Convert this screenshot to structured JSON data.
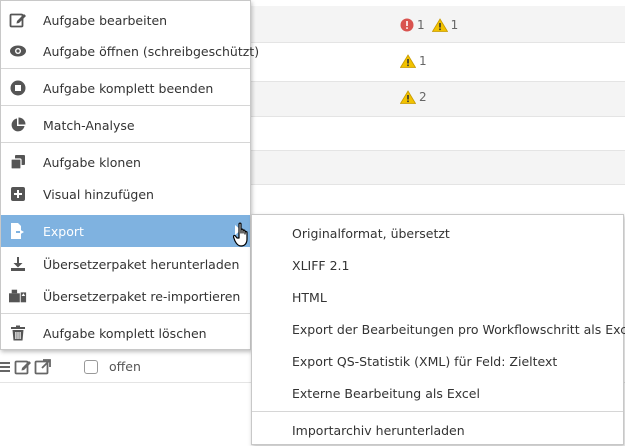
{
  "background_rows": [
    {
      "errors": "1",
      "warnings": "1"
    },
    {
      "errors": null,
      "warnings": "1"
    },
    {
      "errors": null,
      "warnings": "2"
    }
  ],
  "menu": {
    "items": [
      {
        "label": "Aufgabe bearbeiten",
        "icon": "edit-icon"
      },
      {
        "label": "Aufgabe öffnen (schreibgeschützt)",
        "icon": "eye-icon"
      },
      {
        "label": "Aufgabe komplett beenden",
        "icon": "stop-icon"
      },
      {
        "label": "Match-Analyse",
        "icon": "pie-chart-icon"
      },
      {
        "label": "Aufgabe klonen",
        "icon": "clone-icon"
      },
      {
        "label": "Visual hinzufügen",
        "icon": "plus-square-icon"
      },
      {
        "label": "Export",
        "icon": "file-export-icon",
        "active": true
      },
      {
        "label": "Übersetzerpaket herunterladen",
        "icon": "download-icon"
      },
      {
        "label": "Übersetzerpaket re-importieren",
        "icon": "reimport-icon"
      },
      {
        "label": "Aufgabe komplett löschen",
        "icon": "trash-icon"
      }
    ]
  },
  "submenu": {
    "items": [
      {
        "label": "Originalformat, übersetzt"
      },
      {
        "label": "XLIFF 2.1"
      },
      {
        "label": "HTML"
      },
      {
        "label": "Export der Bearbeitungen pro Workflowschritt als Excel"
      },
      {
        "label": "Export QS-Statistik (XML) für Feld: Zieltext"
      },
      {
        "label": "Externe Bearbeitung als Excel"
      },
      {
        "label": "Importarchiv herunterladen"
      }
    ]
  },
  "bottom_row": {
    "status": "offen"
  },
  "colors": {
    "active_bg": "#7fb2e0",
    "error": "#d9534f",
    "warning": "#f2c200"
  }
}
